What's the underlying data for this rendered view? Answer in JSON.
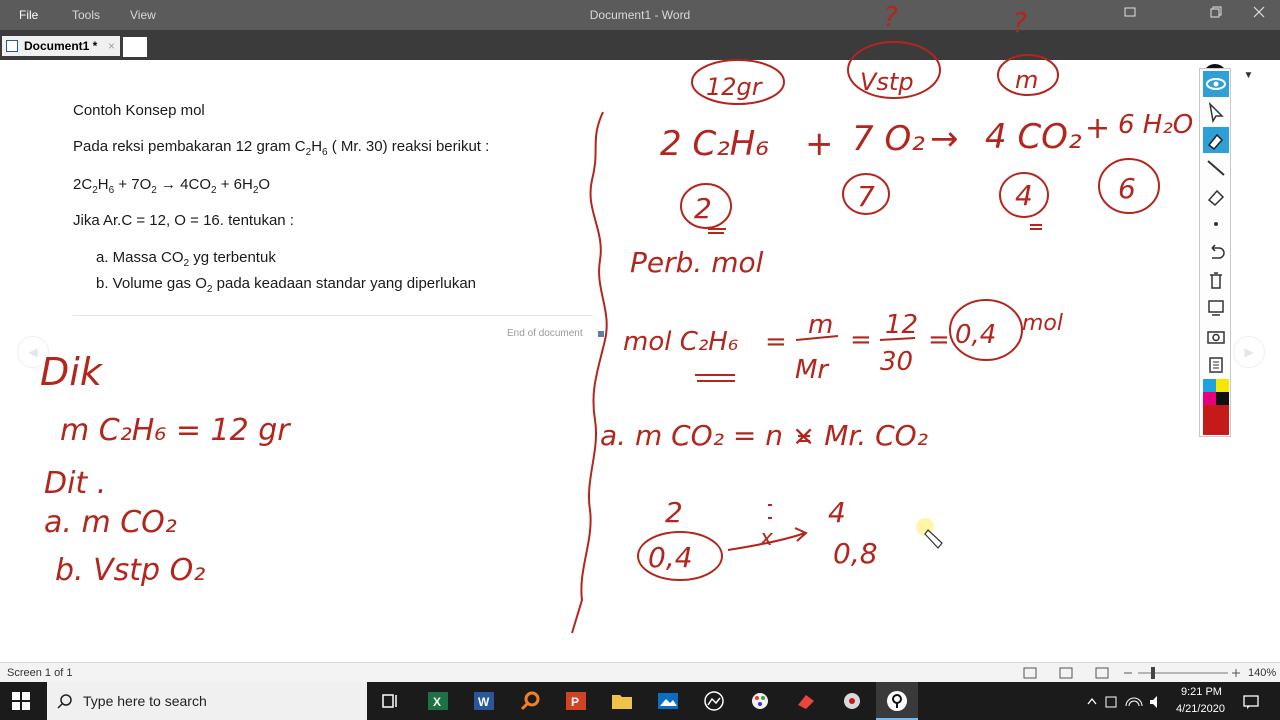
{
  "titlebar": {
    "menu": [
      "File",
      "Tools",
      "View"
    ],
    "title": "Document1 - Word"
  },
  "tabs": {
    "active_tab": "Document1 *",
    "close": "×"
  },
  "document": {
    "heading": "Contoh Konsep mol",
    "line1_a": "Pada reksi pembakaran 12 gram C",
    "line1_sub1": "2",
    "line1_b": "H",
    "line1_sub2": "6",
    "line1_c": " ( Mr. 30) reaksi berikut :",
    "eq": {
      "p1": "2C",
      "s1": "2",
      "p2": "H",
      "s2": "6",
      "p3": " + 7O",
      "s3": "2",
      "p4": " → 4CO",
      "s4": "2",
      "p5": " + 6H",
      "s5": "2",
      "p6": "O"
    },
    "line3": "Jika Ar.C = 12, O = 16. tentukan :",
    "item_a": {
      "p1": "a.  Massa CO",
      "s1": "2",
      "p2": " yg terbentuk"
    },
    "item_b": {
      "p1": "b.  Volume gas O",
      "s1": "2",
      "p2": " pada keadaan standar yang diperlukan"
    },
    "end_of_document": "End of document"
  },
  "handwriting": {
    "dik": "Dik",
    "dik_line": "m C₂H₆  =  12 gr",
    "dit": "Dit .",
    "dit_a": "a.  m CO₂",
    "dit_b": "b.  Vstp O₂",
    "top_12gr": "12gr",
    "top_vstp": "Vstp",
    "top_m": "m",
    "q1": "?",
    "q2": "?",
    "eq_c2h6": "2 C₂H₆",
    "eq_plus1": "+",
    "eq_o2": "7 O₂",
    "eq_arrow": "→",
    "eq_co2": "4 CO₂",
    "eq_plus2": "+",
    "eq_h2o": "6 H₂O",
    "coef_2": "2",
    "coef_7": "7",
    "coef_4": "4",
    "coef_6": "6",
    "perb_mol": "Perb. mol",
    "mol_lhs": "mol C₂H₆",
    "eq_sign1": "=",
    "m_num": "m",
    "m_den": "Mr",
    "eq_sign2": "=",
    "num_12": "12",
    "den_30": "30",
    "eq_sign3": "=",
    "result_04": "0,4",
    "mol_unit": "mol",
    "a_line": "a.  m CO₂  =  n  ×  Mr. CO₂",
    "ratio_2": "2",
    "ratio_4": "4",
    "ratio_x": "x",
    "left_04": "0,4",
    "right_08": "0,8"
  },
  "statusbar": {
    "screen": "Screen 1 of 1",
    "zoom": "140%"
  },
  "taskbar": {
    "search_placeholder": "Type here to search",
    "time": "9:21 PM",
    "date": "4/21/2020"
  },
  "colors": {
    "ink": "#b3261e",
    "titlebar": "#5b5b5b",
    "taskbar": "#1b1b1b",
    "tool_active": "#2f9fd8"
  }
}
